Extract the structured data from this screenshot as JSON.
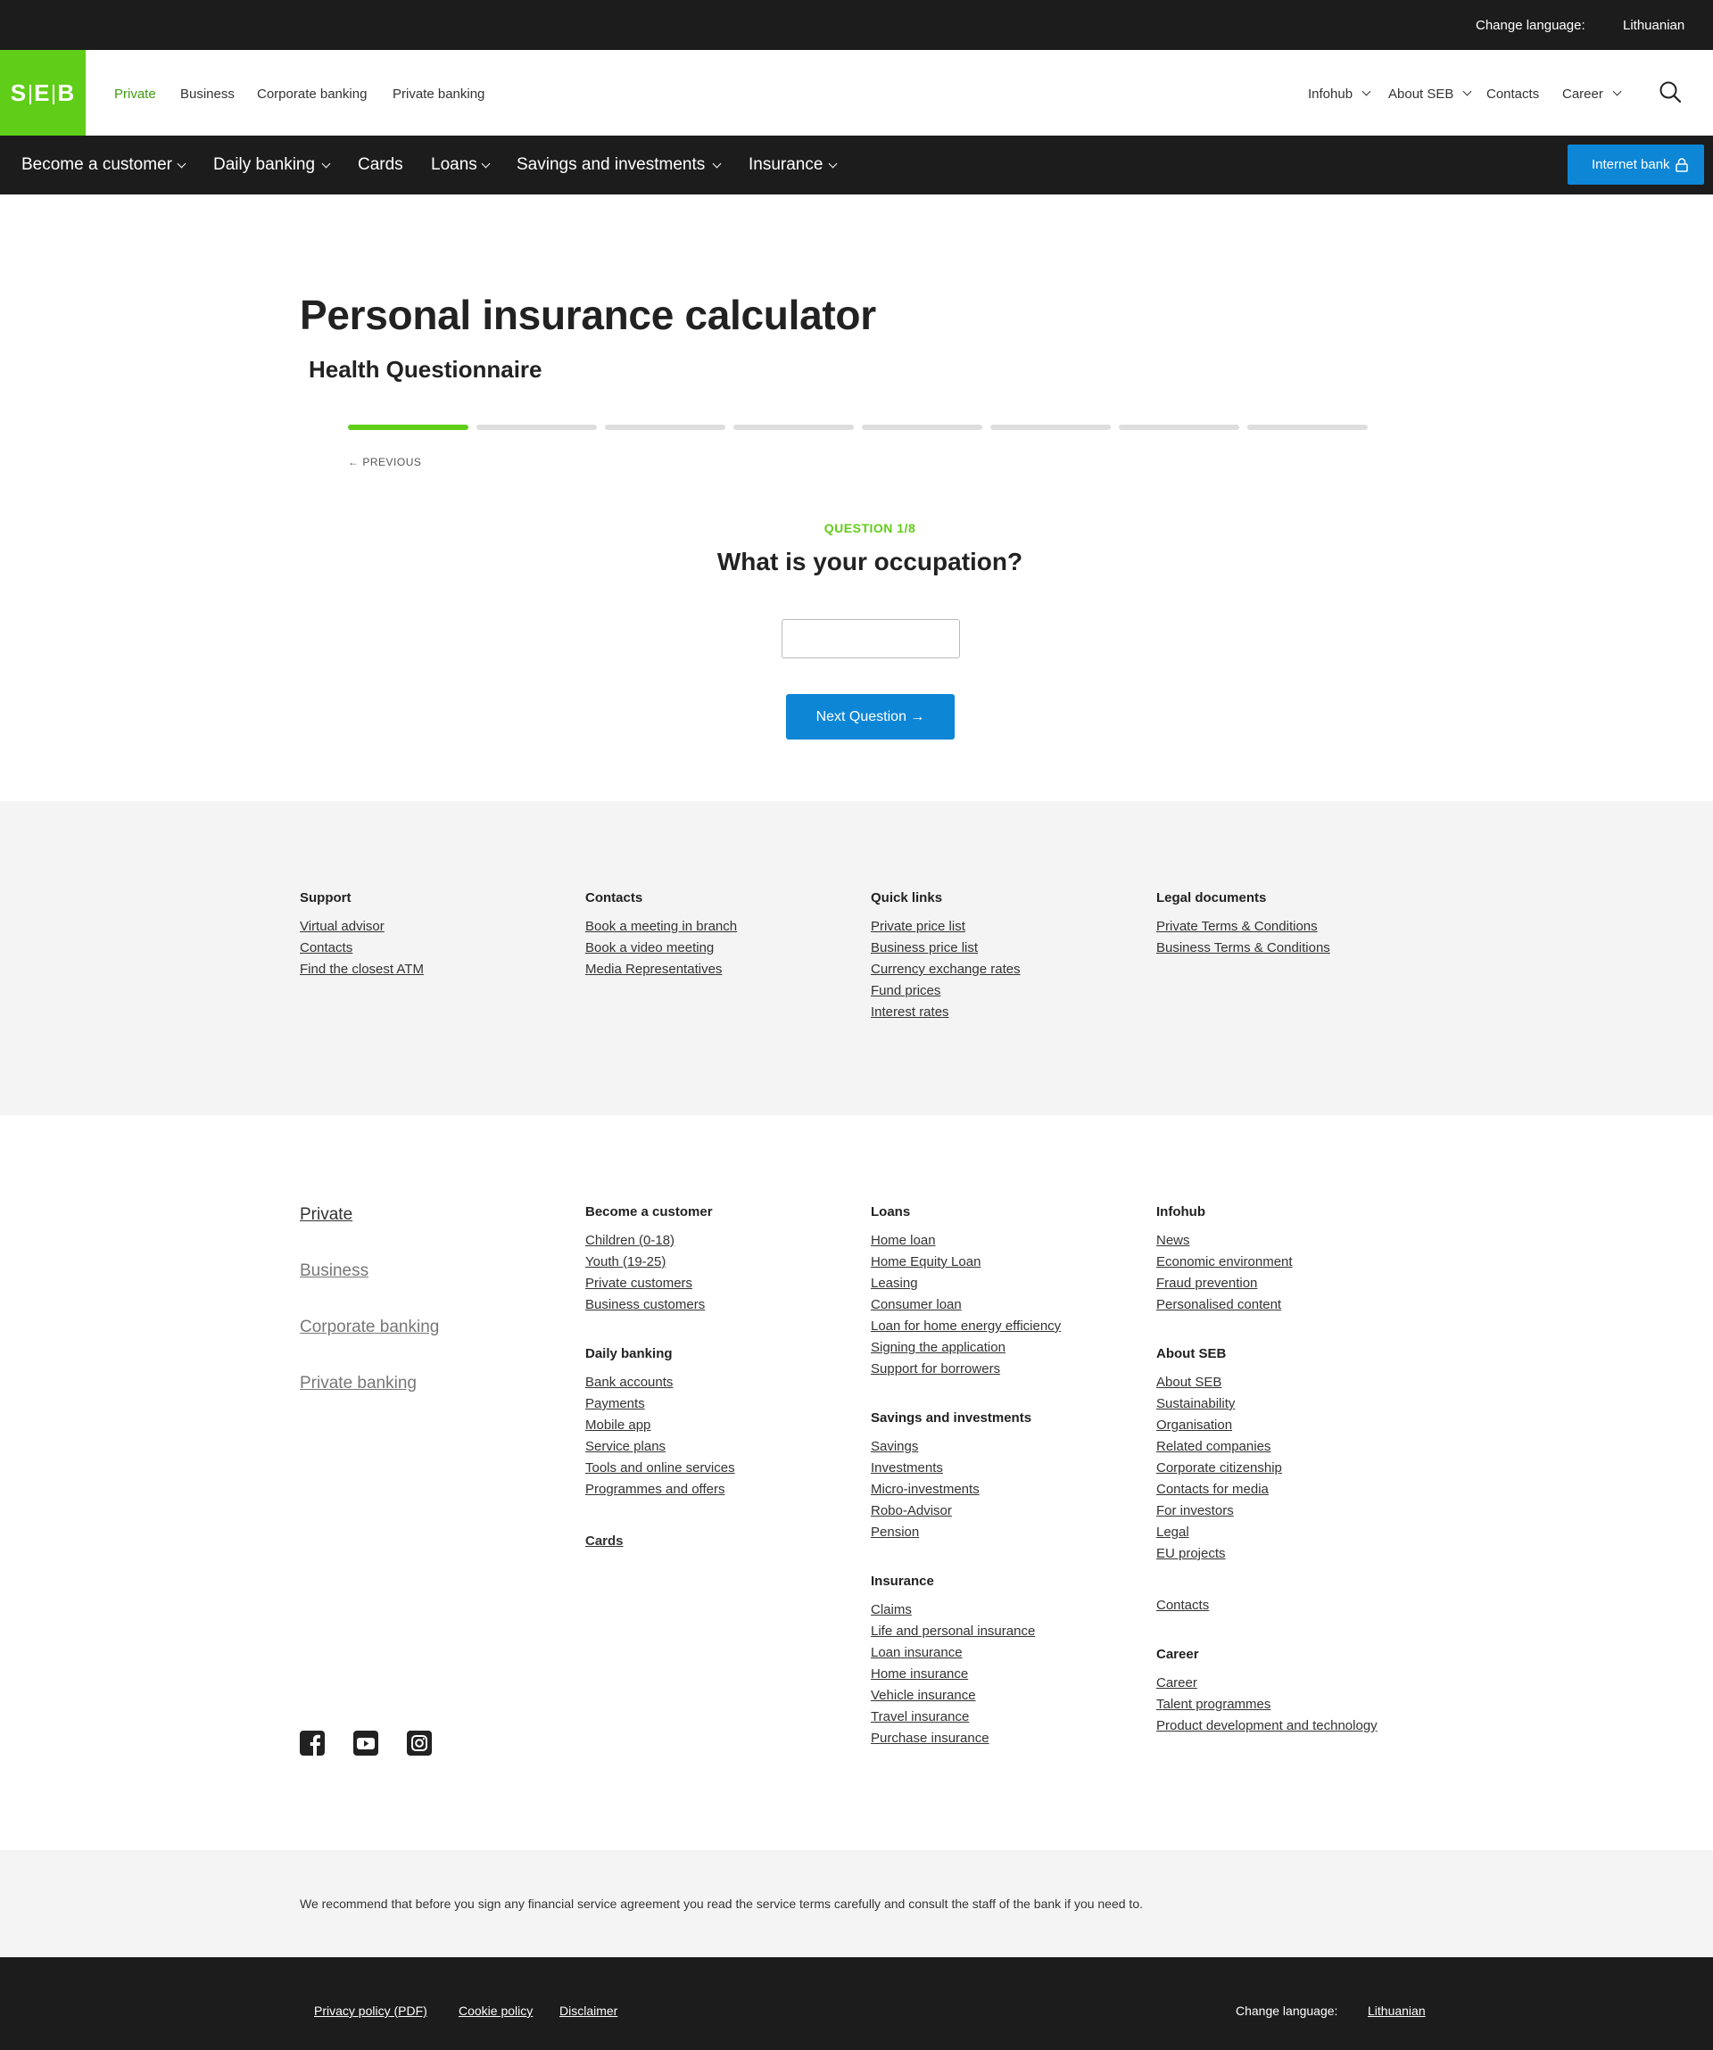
{
  "topbar": {
    "change_language_label": "Change language:",
    "language_link": "Lithuanian"
  },
  "header": {
    "logo_text": "SEB",
    "segments": [
      {
        "label": "Private",
        "active": true
      },
      {
        "label": "Business",
        "active": false
      },
      {
        "label": "Corporate banking",
        "active": false
      },
      {
        "label": "Private banking",
        "active": false
      }
    ],
    "utility": [
      {
        "label": "Infohub",
        "dropdown": true
      },
      {
        "label": "About SEB",
        "dropdown": true
      },
      {
        "label": "Contacts",
        "dropdown": false
      },
      {
        "label": "Career",
        "dropdown": true
      }
    ],
    "search_icon": "search-icon"
  },
  "mainnav": {
    "items": [
      {
        "label": "Become a customer",
        "dropdown": true
      },
      {
        "label": "Daily banking",
        "dropdown": true
      },
      {
        "label": "Cards",
        "dropdown": false
      },
      {
        "label": "Loans",
        "dropdown": true
      },
      {
        "label": "Savings and investments",
        "dropdown": true
      },
      {
        "label": "Insurance",
        "dropdown": true
      }
    ],
    "internet_bank_label": "Internet bank",
    "internet_bank_icon": "lock-icon"
  },
  "content": {
    "title": "Personal insurance calculator",
    "subtitle": "Health Questionnaire",
    "progress": {
      "current": 1,
      "total": 8
    },
    "previous_label": "PREVIOUS",
    "question_number": "QUESTION 1/8",
    "question_text": "What is your occupation?",
    "answer_value": "",
    "next_label": "Next Question"
  },
  "footer_support": {
    "columns": [
      {
        "title": "Support",
        "links": [
          "Virtual advisor",
          "Contacts",
          "Find the closest ATM"
        ]
      },
      {
        "title": "Contacts",
        "links": [
          "Book a meeting in branch",
          "Book a video meeting",
          "Media Representatives"
        ]
      },
      {
        "title": "Quick links",
        "links": [
          "Private price list",
          "Business price list",
          "Currency exchange rates",
          "Fund prices",
          "Interest rates"
        ]
      },
      {
        "title": "Legal documents",
        "links": [
          "Private Terms & Conditions",
          "Business Terms & Conditions"
        ]
      }
    ]
  },
  "footer_main": {
    "segments": [
      "Private",
      "Business",
      "Corporate banking",
      "Private banking"
    ],
    "col2": [
      {
        "title": "Become a customer",
        "links": [
          "Children (0-18)",
          "Youth (19-25)",
          "Private customers",
          "Business customers"
        ]
      },
      {
        "title": "Daily banking",
        "links": [
          "Bank accounts",
          "Payments",
          "Mobile app",
          "Service plans",
          "Tools and online services",
          "Programmes and offers"
        ]
      },
      {
        "title": "Cards",
        "links": []
      }
    ],
    "col3": [
      {
        "title": "Loans",
        "links": [
          "Home loan",
          "Home Equity Loan",
          "Leasing",
          "Consumer loan",
          "Loan for home energy efficiency",
          "Signing the application",
          "Support for borrowers"
        ]
      },
      {
        "title": "Savings and investments",
        "links": [
          "Savings",
          "Investments",
          "Micro-investments",
          "Robo-Advisor",
          "Pension"
        ]
      },
      {
        "title": "Insurance",
        "links": [
          "Claims",
          "Life and personal insurance",
          "Loan insurance",
          "Home insurance",
          "Vehicle insurance",
          "Travel insurance",
          "Purchase insurance"
        ]
      }
    ],
    "col4": [
      {
        "title": "Infohub",
        "links": [
          "News",
          "Economic environment",
          "Fraud prevention",
          "Personalised content"
        ]
      },
      {
        "title": "About SEB",
        "links": [
          "About SEB",
          "Sustainability",
          "Organisation",
          "Related companies",
          "Corporate citizenship",
          "Contacts for media",
          "For investors",
          "Legal",
          "EU projects"
        ]
      },
      {
        "title": "",
        "links": [
          "Contacts"
        ]
      },
      {
        "title": "Career",
        "links": [
          "Career",
          "Talent programmes",
          "Product development and technology"
        ]
      }
    ],
    "social_icons": [
      "facebook-icon",
      "youtube-icon",
      "instagram-icon"
    ]
  },
  "disclaimer": "We recommend that before you sign any financial service agreement you read the service terms carefully and consult the staff of the bank if you need to.",
  "bottombar": {
    "links": [
      "Privacy policy (PDF)",
      "Cookie policy",
      "Disclaimer"
    ],
    "change_language_label": "Change language:",
    "language_link": "Lithuanian"
  },
  "colors": {
    "brand_green": "#60cd18",
    "primary_blue": "#0d86d6",
    "dark_bar": "#1c1c1c",
    "light_band": "#f4f4f4"
  }
}
